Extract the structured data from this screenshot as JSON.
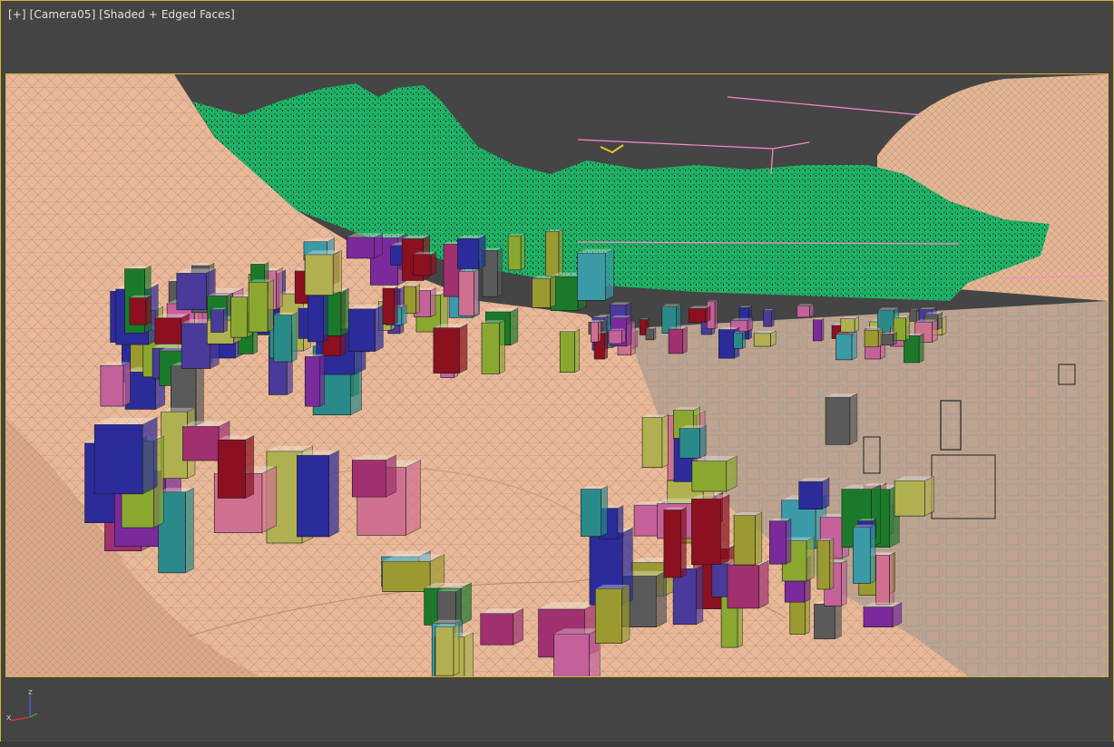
{
  "viewport": {
    "label_plus": "[+]",
    "label_camera": "[Camera05]",
    "label_shading": "[Shaded + Edged Faces]"
  },
  "gizmo": {
    "z_label": "z",
    "x_label": "x"
  },
  "colors": {
    "frame_border": "#d6b23a",
    "background": "#444444",
    "terrain": "#e8b898",
    "vegetation": "#1fb266",
    "wire": "#9a9a9a",
    "axis_z": "#3b6cff",
    "axis_x": "#e0302e"
  }
}
